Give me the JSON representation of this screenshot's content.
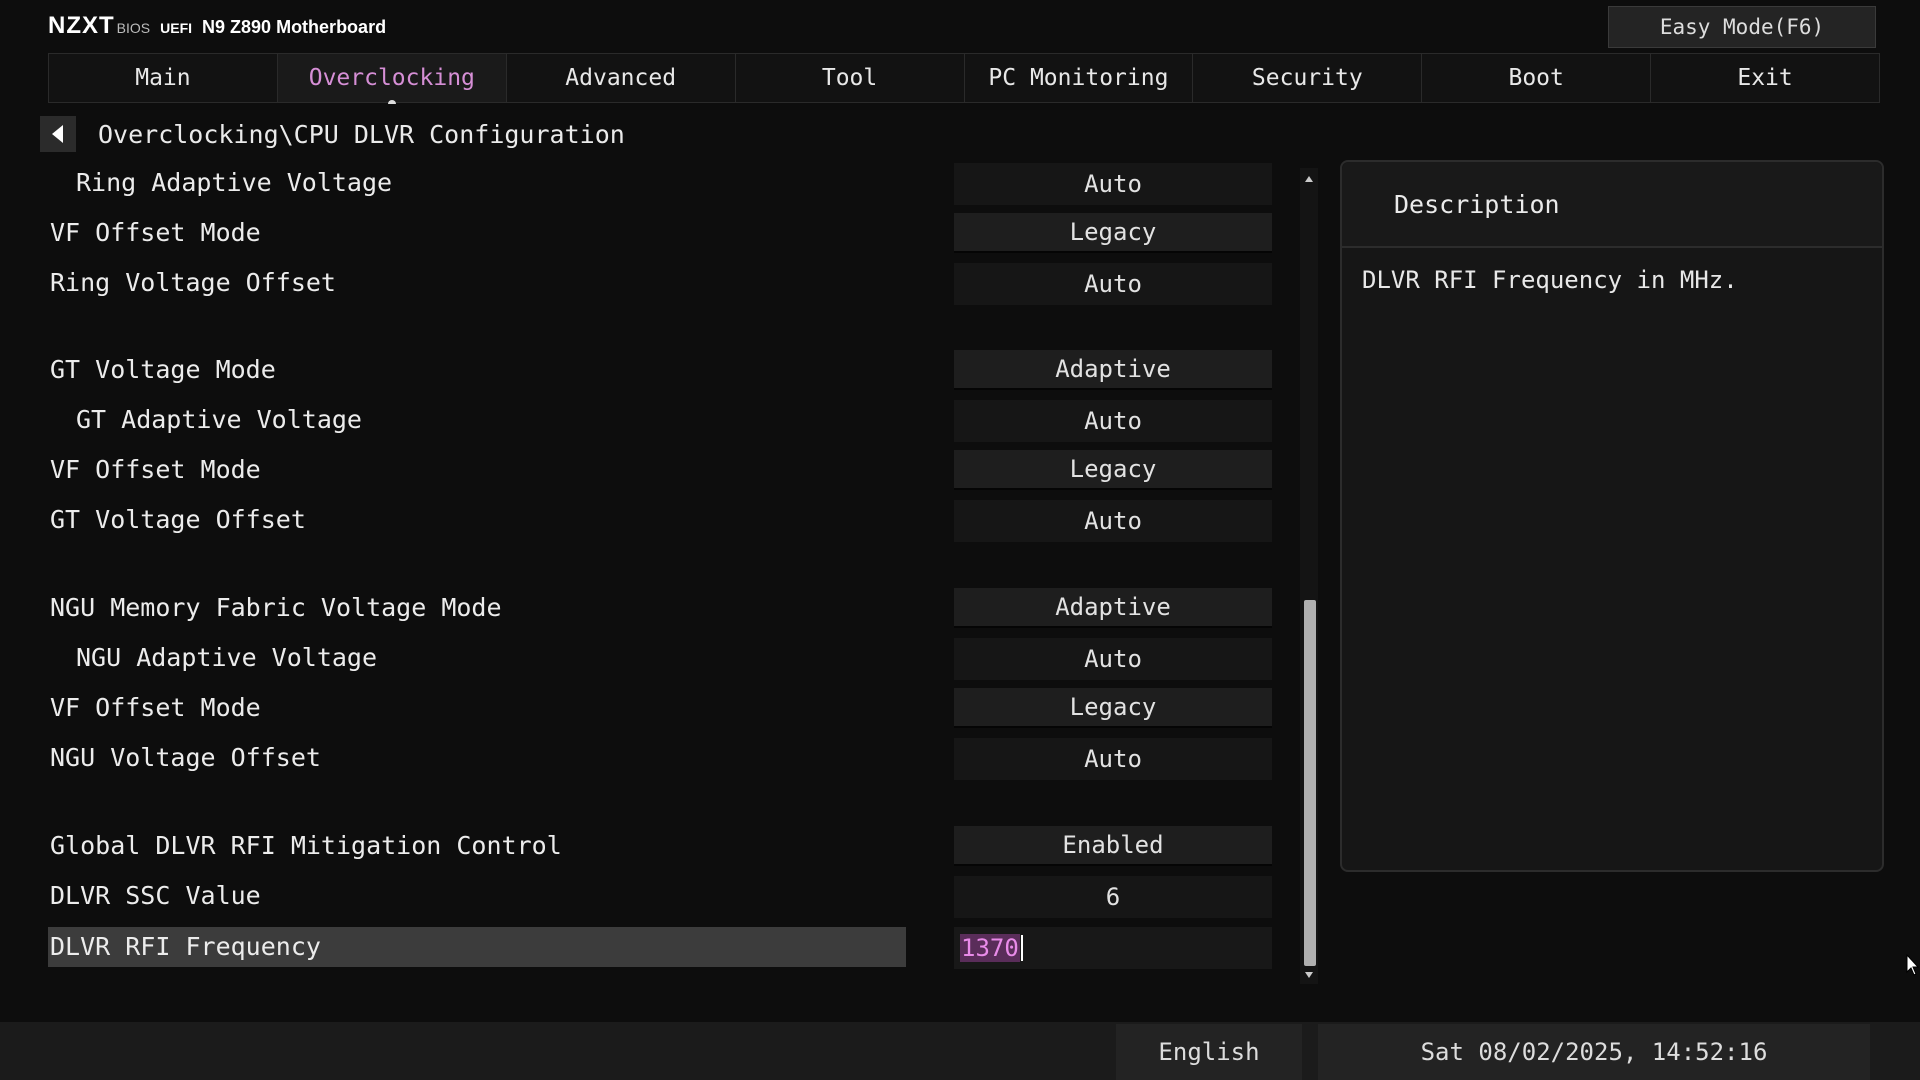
{
  "header": {
    "brand": "NZXT",
    "bios_label": "BIOS",
    "uefi_label": "UEFI",
    "model": "N9 Z890 Motherboard",
    "easy_mode_label": "Easy Mode(F6)"
  },
  "tabs": [
    {
      "label": "Main",
      "active": false
    },
    {
      "label": "Overclocking",
      "active": true
    },
    {
      "label": "Advanced",
      "active": false
    },
    {
      "label": "Tool",
      "active": false
    },
    {
      "label": "PC Monitoring",
      "active": false
    },
    {
      "label": "Security",
      "active": false
    },
    {
      "label": "Boot",
      "active": false
    },
    {
      "label": "Exit",
      "active": false
    }
  ],
  "breadcrumb": "Overclocking\\CPU DLVR Configuration",
  "settings": [
    {
      "label": "Ring Adaptive Voltage",
      "value": "Auto"
    },
    {
      "label": "VF Offset Mode",
      "value": "Legacy"
    },
    {
      "label": "Ring Voltage Offset",
      "value": "Auto"
    },
    {
      "label": "GT Voltage Mode",
      "value": "Adaptive"
    },
    {
      "label": "GT Adaptive Voltage",
      "value": "Auto"
    },
    {
      "label": "VF Offset Mode",
      "value": "Legacy"
    },
    {
      "label": "GT Voltage Offset",
      "value": "Auto"
    },
    {
      "label": "NGU Memory Fabric Voltage Mode",
      "value": "Adaptive"
    },
    {
      "label": "NGU Adaptive Voltage",
      "value": "Auto"
    },
    {
      "label": "VF Offset Mode",
      "value": "Legacy"
    },
    {
      "label": "NGU Voltage Offset",
      "value": "Auto"
    },
    {
      "label": "Global DLVR RFI Mitigation Control",
      "value": "Enabled"
    },
    {
      "label": "DLVR SSC Value",
      "value": "6"
    },
    {
      "label": "DLVR RFI Frequency",
      "value": "1370"
    }
  ],
  "description": {
    "title": "Description",
    "text": "DLVR RFI Frequency in MHz."
  },
  "footer": {
    "language": "English",
    "datetime": "Sat 08/02/2025, 14:52:16"
  },
  "colors": {
    "accent": "#d68fd6",
    "background": "#0d0d0d",
    "selected_row": "#3c3c3c"
  }
}
